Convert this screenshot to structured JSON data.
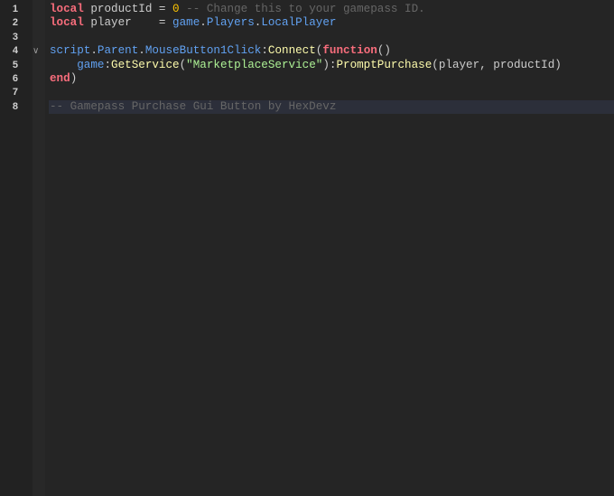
{
  "editor": {
    "line_numbers": [
      "1",
      "2",
      "3",
      "4",
      "5",
      "6",
      "7",
      "8"
    ],
    "fold_icon": "chevron-down-icon",
    "colors": {
      "keyword": "#f86d7c",
      "number": "#ffc600",
      "comment": "#666666",
      "property": "#61a1f1",
      "method": "#fdfbac",
      "string": "#adf195",
      "text": "#cccccc",
      "current_line": "#2c2f3a"
    },
    "lines": [
      {
        "tokens": [
          {
            "t": "local",
            "c": "kw"
          },
          {
            "t": " productId = ",
            "c": ""
          },
          {
            "t": "0",
            "c": "num"
          },
          {
            "t": " -- Change this to your gamepass ID.",
            "c": "cm"
          }
        ]
      },
      {
        "tokens": [
          {
            "t": "local",
            "c": "kw"
          },
          {
            "t": " player    = ",
            "c": ""
          },
          {
            "t": "game",
            "c": "prop"
          },
          {
            "t": ".",
            "c": ""
          },
          {
            "t": "Players",
            "c": "prop"
          },
          {
            "t": ".",
            "c": ""
          },
          {
            "t": "LocalPlayer",
            "c": "prop"
          }
        ]
      },
      {
        "tokens": []
      },
      {
        "tokens": [
          {
            "t": "script",
            "c": "prop"
          },
          {
            "t": ".",
            "c": ""
          },
          {
            "t": "Parent",
            "c": "prop"
          },
          {
            "t": ".",
            "c": ""
          },
          {
            "t": "MouseButton1Click",
            "c": "prop"
          },
          {
            "t": ":",
            "c": ""
          },
          {
            "t": "Connect",
            "c": "meth"
          },
          {
            "t": "(",
            "c": ""
          },
          {
            "t": "function",
            "c": "kw"
          },
          {
            "t": "()",
            "c": ""
          }
        ]
      },
      {
        "tokens": [
          {
            "t": "    ",
            "c": ""
          },
          {
            "t": "game",
            "c": "prop"
          },
          {
            "t": ":",
            "c": ""
          },
          {
            "t": "GetService",
            "c": "meth"
          },
          {
            "t": "(",
            "c": ""
          },
          {
            "t": "\"MarketplaceService\"",
            "c": "str"
          },
          {
            "t": "):",
            "c": ""
          },
          {
            "t": "PromptPurchase",
            "c": "meth"
          },
          {
            "t": "(player, productId)",
            "c": ""
          }
        ]
      },
      {
        "tokens": [
          {
            "t": "end",
            "c": "kw"
          },
          {
            "t": ")",
            "c": ""
          }
        ]
      },
      {
        "tokens": []
      },
      {
        "tokens": [
          {
            "t": "-- Gamepass Purchase Gui Button by HexDevz",
            "c": "cm"
          }
        ]
      }
    ]
  }
}
